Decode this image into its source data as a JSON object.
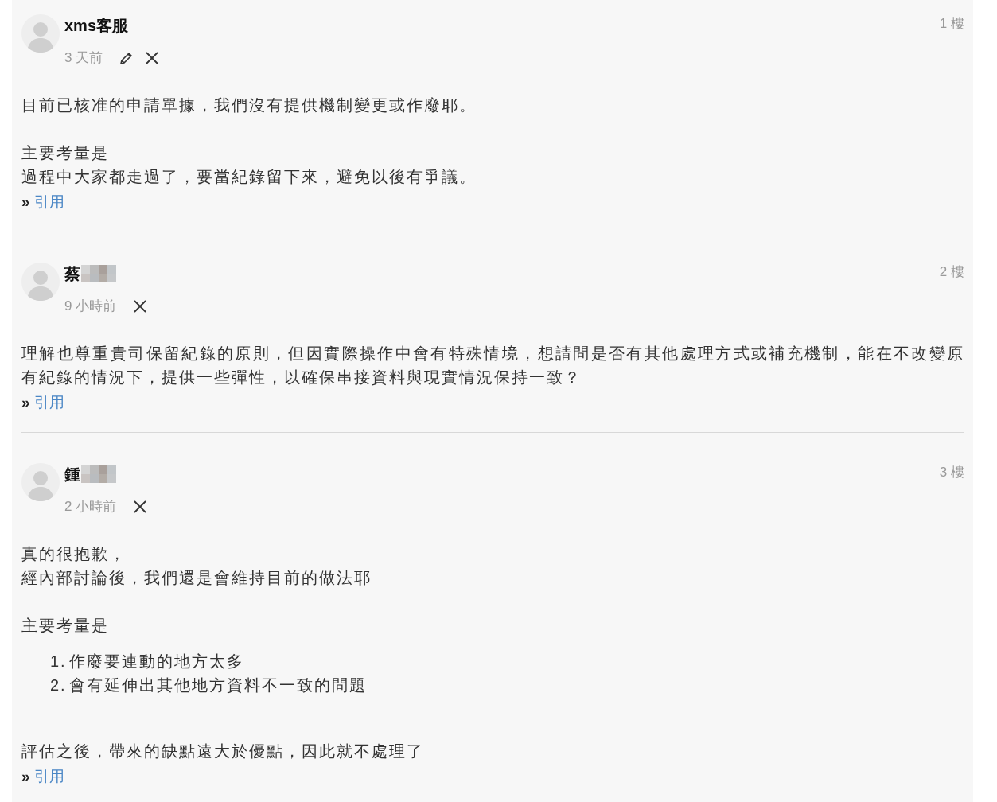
{
  "posts": [
    {
      "author": "xms客服",
      "redacted": false,
      "time": "3 天前",
      "editable": true,
      "deletable": true,
      "floor": "1 樓",
      "body": [
        {
          "kind": "para",
          "lines": [
            "目前已核准的申請單據，我們沒有提供機制變更或作廢耶。"
          ]
        },
        {
          "kind": "para",
          "lines": [
            "主要考量是",
            "過程中大家都走過了，要當紀錄留下來，避免以後有爭議。"
          ]
        }
      ],
      "quote": {
        "marker": "»",
        "label": "引用"
      }
    },
    {
      "author": "蔡",
      "redacted": true,
      "time": "9 小時前",
      "editable": false,
      "deletable": true,
      "floor": "2 樓",
      "body": [
        {
          "kind": "para",
          "lines": [
            "理解也尊重貴司保留紀錄的原則，但因實際操作中會有特殊情境，想請問是否有其他處理方式或補充機制，能在不改變原有紀錄的情況下，提供一些彈性，以確保串接資料與現實情況保持一致？"
          ]
        }
      ],
      "quote": {
        "marker": "»",
        "label": "引用"
      }
    },
    {
      "author": "鍾",
      "redacted": true,
      "time": "2 小時前",
      "editable": false,
      "deletable": true,
      "floor": "3 樓",
      "body": [
        {
          "kind": "para",
          "lines": [
            "真的很抱歉，",
            "經內部討論後，我們還是會維持目前的做法耶"
          ]
        },
        {
          "kind": "para",
          "lines": [
            "主要考量是"
          ]
        },
        {
          "kind": "list",
          "items": [
            {
              "number": "1.",
              "text": "作廢要連動的地方太多"
            },
            {
              "number": "2.",
              "text": "會有延伸出其他地方資料不一致的問題"
            }
          ]
        },
        {
          "kind": "para",
          "lines": [
            "評估之後，帶來的缺點遠大於優點，因此就不處理了"
          ]
        }
      ],
      "quote": {
        "marker": "»",
        "label": "引用"
      }
    }
  ]
}
